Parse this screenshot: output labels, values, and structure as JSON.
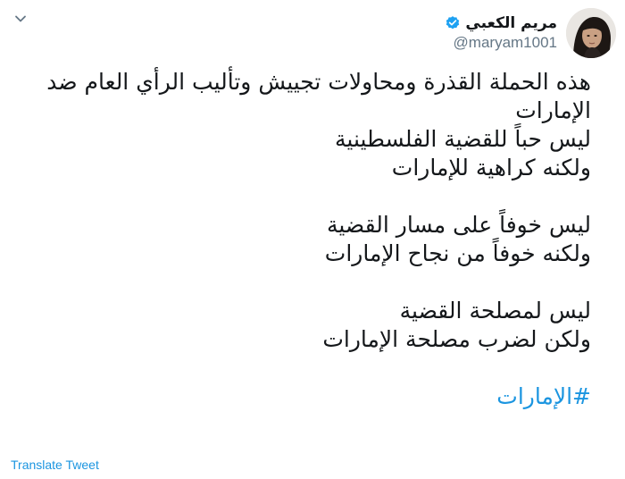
{
  "author": {
    "display_name": "مريم الكعبي",
    "handle": "@maryam1001",
    "verified_icon": "verified-badge-icon"
  },
  "colors": {
    "text": "#14171a",
    "secondary": "#657786",
    "link": "#1b95e0"
  },
  "tweet": {
    "lines": [
      "هذه الحملة القذرة ومحاولات تجييش وتأليب الرأي العام ضد",
      "الإمارات",
      "ليس حباً للقضية الفلسطينية",
      "ولكنه كراهية للإمارات",
      "",
      "ليس خوفاً على مسار القضية",
      "ولكنه خوفاً من نجاح الإمارات",
      "",
      "ليس لمصلحة القضية",
      "ولكن لضرب مصلحة الإمارات"
    ],
    "hashtag": "#الإمارات"
  },
  "actions": {
    "translate_label": "Translate Tweet",
    "caret_icon": "chevron-down-icon"
  }
}
